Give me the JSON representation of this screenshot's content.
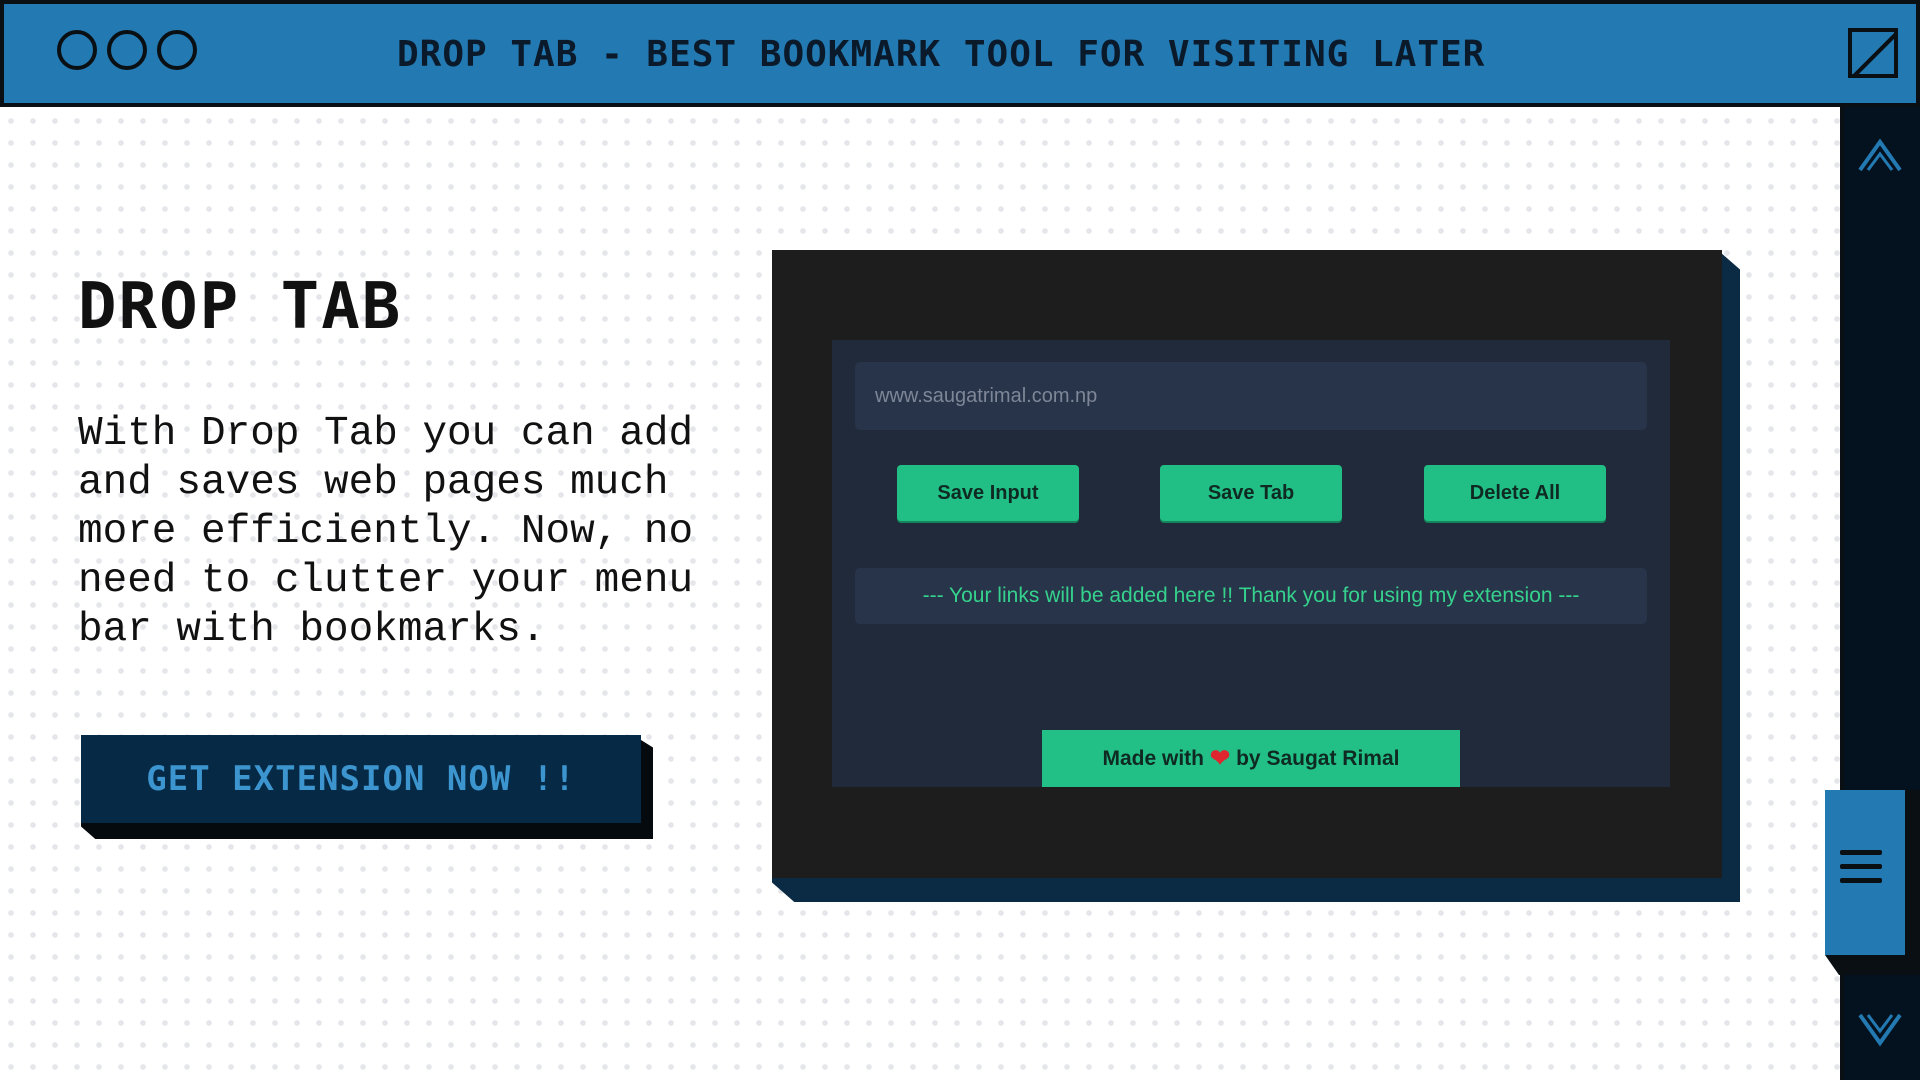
{
  "window": {
    "title": "DROP TAB - BEST BOOKMARK TOOL FOR VISITING LATER",
    "controls": [
      "circle-button",
      "circle-button",
      "circle-button"
    ],
    "maximize_icon": "maximize-icon"
  },
  "hero": {
    "heading": "DROP TAB",
    "description": "With Drop Tab you can add and saves web pages much more efficiently. Now, no need to clutter your menu bar with bookmarks.",
    "cta_label": "GET EXTENSION NOW !!"
  },
  "extension_preview": {
    "url_placeholder": "www.saugatrimal.com.np",
    "buttons": [
      "Save Input",
      "Save Tab",
      "Delete All"
    ],
    "links_message": "--- Your links will be added here !! Thank you for using my extension ---",
    "footer": {
      "before": "Made with",
      "icon": "heart-icon",
      "after": "by Saugat Rimal"
    }
  },
  "scrollbar": {
    "up_icon": "chevron-up-icon",
    "menu_icon": "hamburger-menu-icon",
    "down_icon": "chevron-down-icon"
  },
  "colors": {
    "accent_blue": "#2379b1",
    "dark_navy": "#04121f",
    "cta_bg": "#062a45",
    "cta_text": "#3d95cf",
    "green": "#21bf86",
    "popup_bg": "#202a3a"
  }
}
